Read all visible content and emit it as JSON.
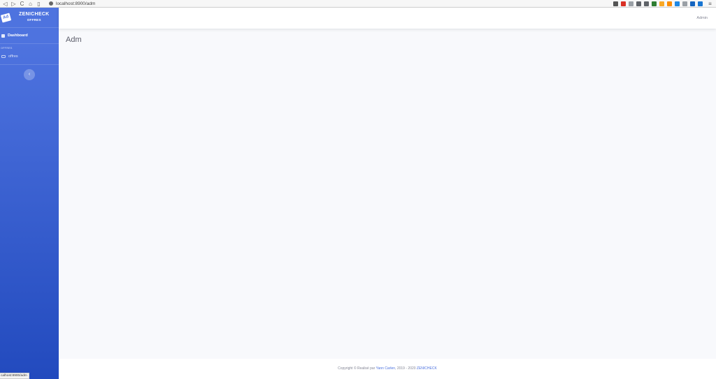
{
  "browser": {
    "url": "localhost:8900/adm",
    "nav": [
      "◁",
      "▷",
      "C",
      "⌂",
      "▯"
    ],
    "extension_icons": [
      "shield-icon",
      "warning-icon",
      "pocket-icon",
      "mask-icon",
      "puzzle-icon",
      "camera-icon",
      "bookmark-icon",
      "tag-icon",
      "edit-icon",
      "panel-icon",
      "plus-icon",
      "sync-icon"
    ],
    "extension_colors": [
      "#555555",
      "#d93025",
      "#9aa0a6",
      "#5f6368",
      "#5f6368",
      "#2e7d32",
      "#f9a825",
      "#fb8c00",
      "#1e88e5",
      "#9aa0a6",
      "#1565c0",
      "#1976d2"
    ],
    "menu_glyph": "≡",
    "status_url": "calhost:8900/adm"
  },
  "sidebar": {
    "brand_logo": "Ad",
    "brand_title": "ZENICHECK",
    "brand_subtitle": "OFFRES",
    "dashboard_label": "Dashboard",
    "section_heading": "OFFRES",
    "offres_label": "offres",
    "toggle_glyph": "‹"
  },
  "topbar": {
    "user_label": "Admin"
  },
  "main": {
    "page_title": "Adm"
  },
  "footer": {
    "prefix": "Copyright © Realisé par ",
    "author": "Yann Carlen",
    "middle": ", 2019 - 2020 ",
    "brand": "ZENICHECK"
  },
  "colors": {
    "accent": "#4e73df",
    "sidebar_bottom": "#224abe",
    "background": "#f8f9fc"
  }
}
